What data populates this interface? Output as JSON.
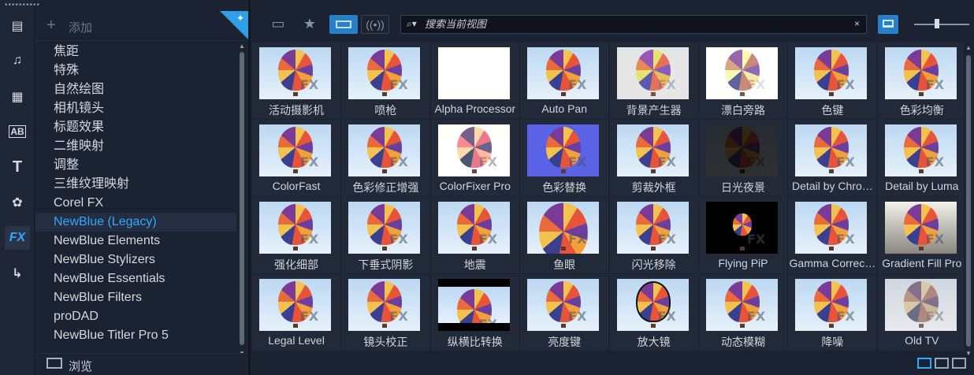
{
  "rail": {
    "dots": "••••••••••",
    "items": [
      {
        "id": "media",
        "icon": "media-icon",
        "glyph": "▤"
      },
      {
        "id": "sound",
        "icon": "music-note-icon",
        "glyph": "♫"
      },
      {
        "id": "instant-project",
        "icon": "clapper-icon",
        "glyph": "▦"
      },
      {
        "id": "title",
        "icon": "title-ab-icon",
        "glyph": "AB"
      },
      {
        "id": "text",
        "icon": "text-t-icon",
        "glyph": "T"
      },
      {
        "id": "graphics",
        "icon": "graphics-icon",
        "glyph": "✿"
      },
      {
        "id": "fx",
        "icon": "fx-icon",
        "glyph": "FX"
      },
      {
        "id": "path",
        "icon": "path-icon",
        "glyph": "↳"
      }
    ]
  },
  "category_panel": {
    "add_label": "添加",
    "categories": [
      "焦距",
      "特殊",
      "自然绘图",
      "相机镜头",
      "标题效果",
      "二维映射",
      "调整",
      "三维纹理映射",
      "Corel FX",
      "NewBlue (Legacy)",
      "NewBlue Elements",
      "NewBlue Stylizers",
      "NewBlue Essentials",
      "NewBlue Filters",
      "proDAD",
      "NewBlue Titler Pro 5"
    ],
    "selected": "NewBlue (Legacy)",
    "browse_label": "浏览"
  },
  "toolbar": {
    "search_placeholder": "搜索当前视图",
    "clear_glyph": "×"
  },
  "effects": [
    "活动摄影机",
    "喷枪",
    "Alpha Processor",
    "Auto Pan",
    "背景产生器",
    "漂白旁路",
    "色键",
    "色彩均衡",
    "ColorFast",
    "色彩修正增强",
    "ColorFixer Pro",
    "色彩替换",
    "剪裁外框",
    "日光夜景",
    "Detail by Chro…",
    "Detail by Luma",
    "强化细部",
    "下垂式阴影",
    "地震",
    "鱼眼",
    "闪光移除",
    "Flying PiP",
    "Gamma Correc…",
    "Gradient Fill Pro",
    "Legal Level",
    "镜头校正",
    "纵横比转换",
    "亮度键",
    "放大镜",
    "动态模糊",
    "降噪",
    "Old TV"
  ],
  "thumbnail_watermark": "FX"
}
